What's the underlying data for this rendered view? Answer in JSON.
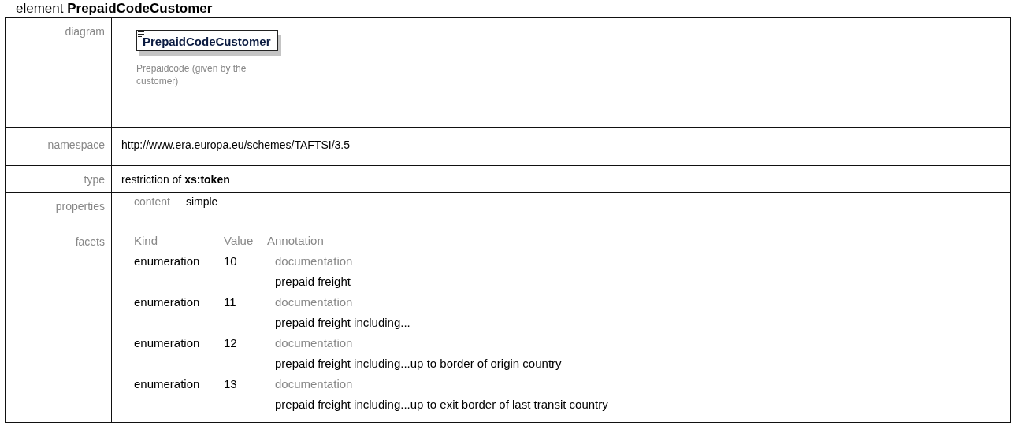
{
  "heading": "element **PrepaidCodeCustomer**",
  "rows": [
    {
      "kind": "diagram",
      "label": "diagram",
      "element_name": "PrepaidCodeCustomer",
      "caption": "Prepaidcode (given by the customer)"
    },
    {
      "kind": "text",
      "label": "namespace",
      "value": "http://www.era.europa.eu/schemes/TAFTSI/3.5"
    },
    {
      "kind": "text",
      "label": "type",
      "value": "restriction of **xs:token**"
    },
    {
      "kind": "properties",
      "label": "properties",
      "items": [
        {
          "name": "content",
          "value": "simple"
        }
      ]
    },
    {
      "kind": "facets",
      "label": "facets",
      "columns": [
        "Kind",
        "Value",
        "Annotation"
      ],
      "facets": [
        {
          "kind": "enumeration",
          "value": "10",
          "annotation_label": "documentation",
          "annotation": "prepaid freight"
        },
        {
          "kind": "enumeration",
          "value": "11",
          "annotation_label": "documentation",
          "annotation": "prepaid freight including..."
        },
        {
          "kind": "enumeration",
          "value": "12",
          "annotation_label": "documentation",
          "annotation": "prepaid freight including...up to border of origin country"
        },
        {
          "kind": "enumeration",
          "value": "13",
          "annotation_label": "documentation",
          "annotation": "prepaid freight including...up to exit border of last transit country"
        }
      ]
    }
  ]
}
